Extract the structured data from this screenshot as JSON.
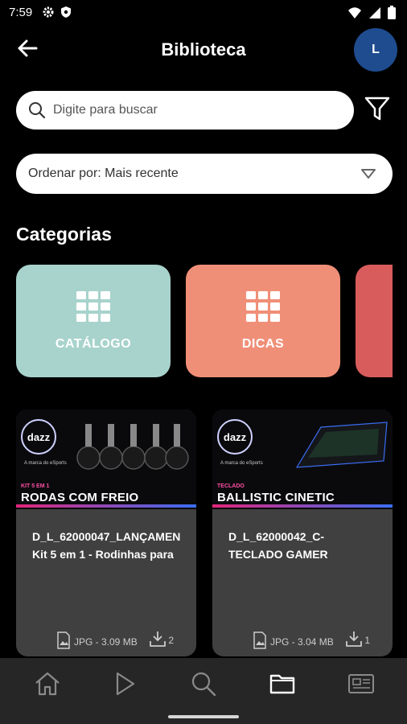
{
  "status_bar": {
    "time": "7:59",
    "left_icons": [
      "gear-icon",
      "shield-icon"
    ],
    "right_icons": [
      "wifi-icon",
      "signal-icon",
      "battery-icon"
    ]
  },
  "header": {
    "title": "Biblioteca",
    "back_icon": "arrow-left-icon",
    "avatar_initial": "L",
    "avatar_color": "#1e4c8f"
  },
  "search": {
    "placeholder": "Digite para buscar",
    "value": ""
  },
  "sort": {
    "label": "Ordenar por: Mais recente"
  },
  "categories": {
    "title": "Categorias",
    "items": [
      {
        "label": "CATÁLOGO",
        "color": "#a8d3cc"
      },
      {
        "label": "DICAS",
        "color": "#f08f78"
      },
      {
        "label": "",
        "color": "#d95c5c"
      }
    ]
  },
  "files": [
    {
      "name_line1": "D_L_62000047_LANÇAMEN",
      "name_line2": "Kit 5 em 1 - Rodinhas para",
      "meta": "JPG - 3.09 MB",
      "downloads": "2",
      "thumb": {
        "logo": "dazz",
        "logo_sub": "A marca do eSports",
        "small": "KIT 5 EM 1",
        "headline": "RODAS COM FREIO"
      }
    },
    {
      "name_line1": "D_L_62000042_C-",
      "name_line2": "TECLADO GAMER",
      "meta": "JPG - 3.04 MB",
      "downloads": "1",
      "thumb": {
        "logo": "dazz",
        "logo_sub": "A marca do eSports",
        "small": "TECLADO",
        "headline": "BALLISTIC CINETIC"
      }
    }
  ],
  "bottom_nav": {
    "items": [
      "home-icon",
      "play-icon",
      "search-icon",
      "folder-icon",
      "news-icon"
    ],
    "active": "folder-icon"
  }
}
